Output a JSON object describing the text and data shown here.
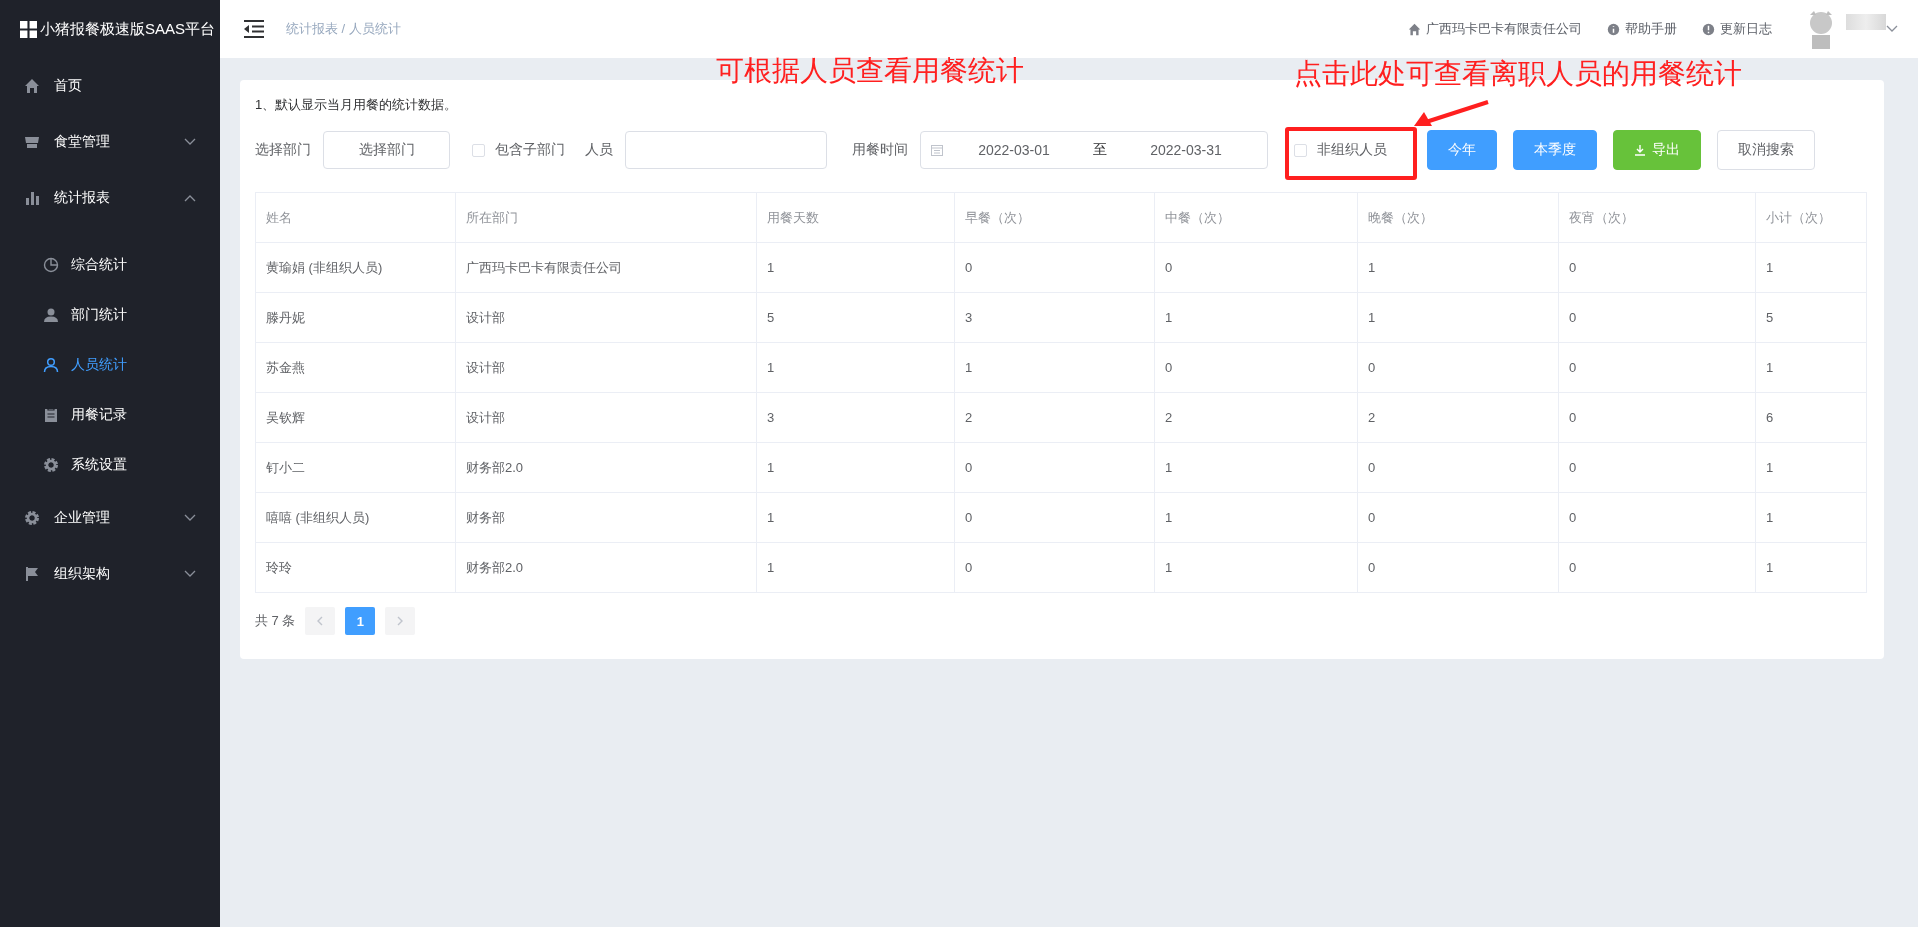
{
  "app": {
    "title": "小猪报餐极速版SAAS平台"
  },
  "sidebar": {
    "items": [
      {
        "label": "首页",
        "kind": "link",
        "selected": false
      },
      {
        "label": "食堂管理",
        "kind": "group",
        "expanded": false,
        "selected": false
      },
      {
        "label": "统计报表",
        "kind": "group",
        "expanded": true,
        "selected": false,
        "children": [
          {
            "label": "综合统计",
            "selected": false
          },
          {
            "label": "部门统计",
            "selected": false
          },
          {
            "label": "人员统计",
            "selected": true
          },
          {
            "label": "用餐记录",
            "selected": false
          },
          {
            "label": "系统设置",
            "selected": false
          }
        ]
      },
      {
        "label": "企业管理",
        "kind": "group",
        "expanded": false,
        "selected": false
      },
      {
        "label": "组织架构",
        "kind": "group",
        "expanded": false,
        "selected": false
      }
    ]
  },
  "header": {
    "breadcrumb": "统计报表 / 人员统计",
    "links": [
      "广西玛卡巴卡有限责任公司",
      "帮助手册",
      "更新日志"
    ]
  },
  "notice": "1、默认显示当月用餐的统计数据。",
  "filters": {
    "dept_label": "选择部门",
    "dept_button": "选择部门",
    "include_sub": {
      "label": "包含子部门",
      "checked": false
    },
    "person_label": "人员",
    "time_label": "用餐时间",
    "date_start": "2022-03-01",
    "date_sep": "至",
    "date_end": "2022-03-31",
    "non_org": {
      "label": "非组织人员",
      "checked": false
    },
    "buttons": [
      {
        "label": "今年",
        "kind": "primary"
      },
      {
        "label": "本季度",
        "kind": "primary"
      },
      {
        "label": "导出",
        "kind": "success"
      },
      {
        "label": "取消搜索",
        "kind": "default"
      }
    ]
  },
  "table": {
    "columns": [
      "姓名",
      "所在部门",
      "用餐天数",
      "早餐（次）",
      "中餐（次）",
      "晚餐（次）",
      "夜宵（次）",
      "小计（次）"
    ],
    "rows": [
      [
        "黄瑜娟 (非组织人员)",
        "广西玛卡巴卡有限责任公司",
        "1",
        "0",
        "0",
        "1",
        "0",
        "1"
      ],
      [
        "滕丹妮",
        "设计部",
        "5",
        "3",
        "1",
        "1",
        "0",
        "5"
      ],
      [
        "苏金燕",
        "设计部",
        "1",
        "1",
        "0",
        "0",
        "0",
        "1"
      ],
      [
        "吴钦辉",
        "设计部",
        "3",
        "2",
        "2",
        "2",
        "0",
        "6"
      ],
      [
        "钉小二",
        "财务部2.0",
        "1",
        "0",
        "1",
        "0",
        "0",
        "1"
      ],
      [
        "嘻嘻 (非组织人员)",
        "财务部",
        "1",
        "0",
        "1",
        "0",
        "0",
        "1"
      ],
      [
        "玲玲",
        "财务部2.0",
        "1",
        "0",
        "1",
        "0",
        "0",
        "1"
      ]
    ]
  },
  "pagination": {
    "total": "共 7 条",
    "pages": [
      {
        "label": "1",
        "selected": true
      }
    ]
  },
  "annotations": [
    "可根据人员查看用餐统计",
    "点击此处可查看离职人员的用餐统计"
  ]
}
